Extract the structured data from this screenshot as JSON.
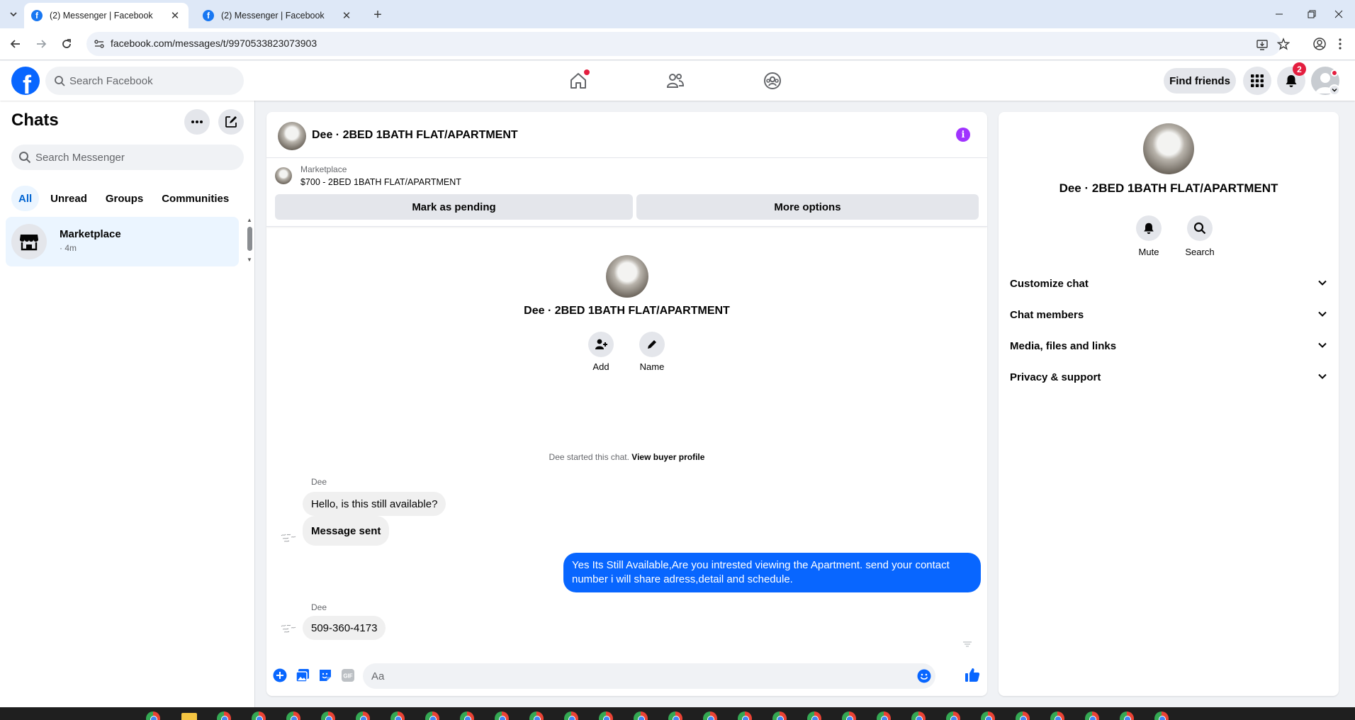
{
  "browser": {
    "tabs": [
      {
        "title": "(2) Messenger | Facebook",
        "active": true
      },
      {
        "title": "(2) Messenger | Facebook",
        "active": false
      }
    ],
    "url": "facebook.com/messages/t/9970533823073903"
  },
  "fb_header": {
    "search_placeholder": "Search Facebook",
    "find_friends_label": "Find friends",
    "notification_count": "2"
  },
  "sidebar": {
    "title": "Chats",
    "search_placeholder": "Search Messenger",
    "filters": [
      "All",
      "Unread",
      "Groups",
      "Communities"
    ],
    "active_filter": "All",
    "chats": [
      {
        "name": "Marketplace",
        "time": "· 4m"
      }
    ]
  },
  "conversation": {
    "title": "Dee · 2BED 1BATH FLAT/APARTMENT",
    "marketplace": {
      "label": "Marketplace",
      "listing": "$700 - 2BED 1BATH FLAT/APARTMENT",
      "pending_button": "Mark as pending",
      "more_button": "More options"
    },
    "intro": {
      "name": "Dee · 2BED 1BATH FLAT/APARTMENT",
      "actions": [
        "Add",
        "Name"
      ]
    },
    "system_message": {
      "text": "Dee started this chat.",
      "link": "View buyer profile"
    },
    "messages": [
      {
        "sender": "Dee",
        "text": "Hello, is this still available?",
        "direction": "incoming"
      },
      {
        "text": "Message sent",
        "direction": "incoming"
      },
      {
        "text": "Yes Its Still Available,Are you intrested viewing the Apartment. send your contact number i will share adress,detail and schedule.",
        "direction": "outgoing"
      },
      {
        "sender": "Dee",
        "text": "509-360-4173",
        "direction": "incoming"
      }
    ],
    "composer_placeholder": "Aa"
  },
  "info_panel": {
    "name": "Dee · 2BED 1BATH FLAT/APARTMENT",
    "actions": [
      "Mute",
      "Search"
    ],
    "sections": [
      "Customize chat",
      "Chat members",
      "Media, files and links",
      "Privacy & support"
    ]
  },
  "colors": {
    "brand": "#0866ff",
    "outgoing_bubble": "#0866ff",
    "active_chat_bg": "#ebf5ff",
    "info_icon": "#a033ff",
    "badge": "#e41e3f"
  }
}
